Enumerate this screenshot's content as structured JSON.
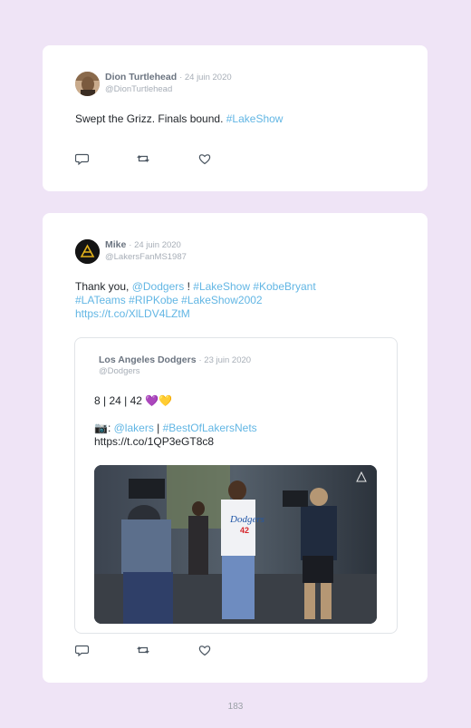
{
  "tweets": [
    {
      "name": "Dion Turtlehead",
      "date": "· 24 juin 2020",
      "handle": "@DionTurtlehead",
      "text_plain": "Swept the Grizz. Finals bound. ",
      "text_hashtag": "#LakeShow"
    },
    {
      "name": "Mike",
      "date": "· 24 juin 2020",
      "handle": "@LakersFanMS1987",
      "line1_plain": "Thank you, ",
      "line1_mention": "@Dodgers",
      "line1_rest_plain": " ! ",
      "line1_tags": "#LakeShow #KobeBryant",
      "line2_tags": "#LATeams #RIPKobe #LakeShow2002",
      "line3_url": "https://t.co/XlLDV4LZtM",
      "quote": {
        "name": "Los Angeles Dodgers",
        "date": "· 23 juin 2020",
        "handle": "@Dodgers",
        "line1": "8 | 24 | 42 ",
        "line1_emoji": "💜💛",
        "line2_icon": "📷",
        "line2_mention": "@lakers",
        "line2_sep": " | ",
        "line2_tag": "#BestOfLakersNets",
        "line3_url": "https://t.co/1QP3eGT8c8",
        "jersey_text": "Dodgers",
        "jersey_number": "42"
      }
    }
  ],
  "page_number": "183",
  "colors": {
    "background": "#efe4f6",
    "link": "#62b6e4",
    "card": "#ffffff"
  }
}
